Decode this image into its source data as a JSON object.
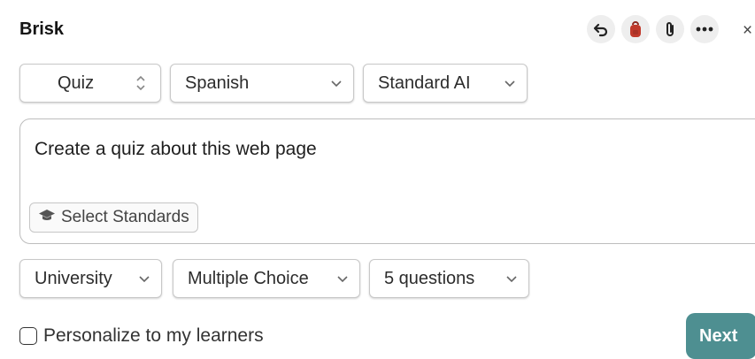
{
  "header": {
    "app_name": "Brisk",
    "icons": [
      "undo-icon",
      "backpack-icon",
      "paperclip-icon",
      "more-icon",
      "close-icon"
    ],
    "close_glyph": "×"
  },
  "options_row": {
    "type": {
      "value": "Quiz"
    },
    "language": {
      "value": "Spanish"
    },
    "model": {
      "value": "Standard AI"
    }
  },
  "prompt": {
    "text": "Create a quiz about this web page",
    "standards_button": "Select Standards"
  },
  "settings_row": {
    "level": {
      "value": "University"
    },
    "question_type": {
      "value": "Multiple Choice"
    },
    "count": {
      "value": "5 questions"
    }
  },
  "personalize": {
    "label": "Personalize to my learners",
    "checked": false
  },
  "next_button": "Next",
  "colors": {
    "accent": "#4e8f91",
    "backpack": "#c0392b"
  }
}
